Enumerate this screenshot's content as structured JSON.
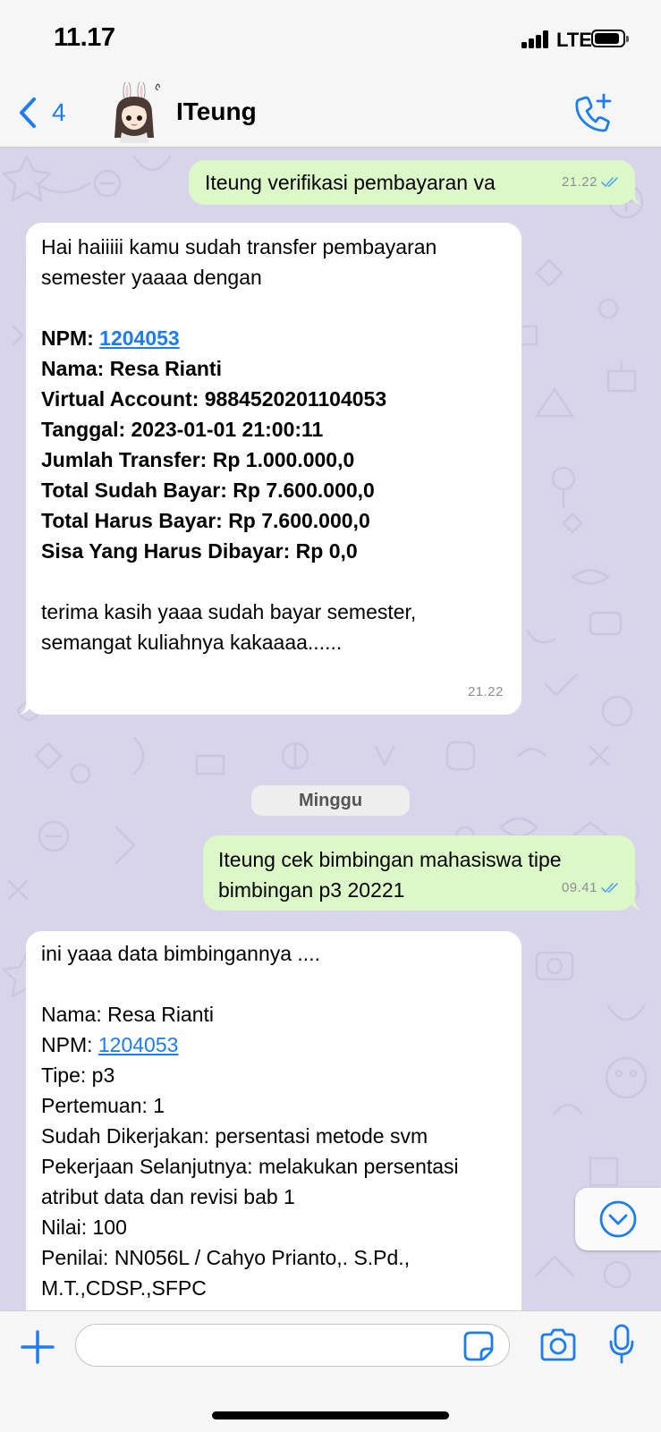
{
  "status_bar": {
    "time": "11.17",
    "network": "LTE"
  },
  "header": {
    "back_count": "4",
    "contact_name": "ITeung"
  },
  "messages": {
    "m1": {
      "text": "Iteung verifikasi pembayaran va",
      "time": "21.22"
    },
    "m2": {
      "line1": "Hai haiiiii kamu sudah transfer pembayaran",
      "line2": "semester yaaaa dengan",
      "npm_label": "NPM: ",
      "npm": "1204053",
      "nama": "Nama: Resa Rianti",
      "va": "Virtual Account: 9884520201104053",
      "tanggal": "Tanggal: 2023-01-01 21:00:11",
      "jumlah": "Jumlah Transfer: Rp 1.000.000,0",
      "total_sudah": "Total Sudah Bayar: Rp 7.600.000,0",
      "total_harus": "Total Harus Bayar: Rp 7.600.000,0",
      "sisa": "Sisa Yang Harus Dibayar: Rp 0,0",
      "closing1": "terima kasih yaaa sudah bayar semester,",
      "closing2": "semangat kuliahnya kakaaaa......",
      "time": "21.22"
    },
    "date_separator": "Minggu",
    "m3": {
      "line1": "Iteung cek bimbingan mahasiswa tipe",
      "line2": "bimbingan p3 20221",
      "time": "09.41"
    },
    "m4": {
      "line1": "ini yaaa data bimbingannya ....",
      "nama": "Nama: Resa Rianti",
      "npm_label": "NPM: ",
      "npm": "1204053",
      "tipe": "Tipe: p3",
      "pertemuan": "Pertemuan: 1",
      "sudah": "Sudah Dikerjakan: persentasi metode svm",
      "pekerjaan1": "Pekerjaan Selanjutnya: melakukan persentasi",
      "pekerjaan2": "atribut data dan revisi bab 1",
      "nilai": "Nilai: 100",
      "penilai1": "Penilai: NN056L / Cahyo Prianto,. S.Pd.,",
      "penilai2": "M.T.,CDSP.,SFPC"
    }
  },
  "colors": {
    "accent": "#1c7cf0",
    "outgoing": "#dcf8c6",
    "incoming": "#ffffff",
    "wallpaper": "#d8d4ea"
  },
  "icons": [
    "chevron-left-icon",
    "add-call-icon",
    "plus-icon",
    "sticker-icon",
    "camera-icon",
    "mic-icon",
    "chevron-down-icon",
    "double-check-icon"
  ]
}
